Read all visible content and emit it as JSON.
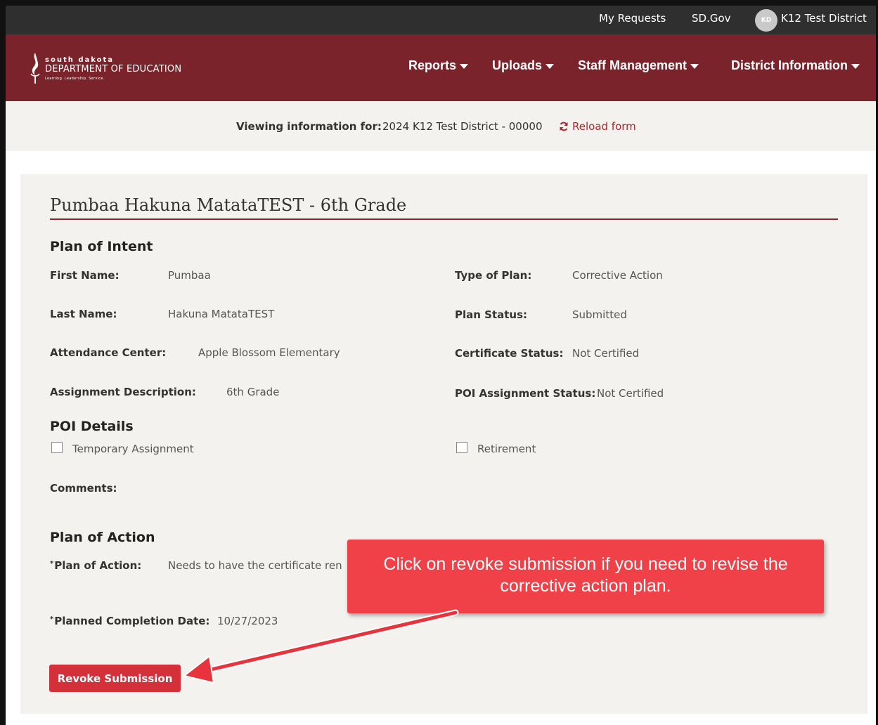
{
  "topbar": {
    "my_requests": "My Requests",
    "sdgov": "SD.Gov",
    "avatar_initials": "KD",
    "district": "K12 Test District"
  },
  "logo": {
    "line1": "south dakota",
    "line2": "DEPARTMENT OF EDUCATION",
    "tagline": "Learning. Leadership. Service."
  },
  "nav": {
    "items": [
      {
        "label": "Reports"
      },
      {
        "label": "Uploads"
      },
      {
        "label": "Staff Management"
      },
      {
        "label": "District Information"
      }
    ]
  },
  "viewing": {
    "label": "Viewing information for:",
    "value": "2024 K12 Test District - 00000",
    "reload": "Reload form"
  },
  "record": {
    "title": "Pumbaa Hakuna MatataTEST - 6th Grade",
    "plan_of_intent": {
      "heading": "Plan of Intent",
      "first_name_label": "First Name:",
      "first_name": "Pumbaa",
      "last_name_label": "Last Name:",
      "last_name": "Hakuna MatataTEST",
      "attendance_center_label": "Attendance Center:",
      "attendance_center": "Apple Blossom Elementary",
      "assignment_description_label": "Assignment Description:",
      "assignment_description": "6th Grade",
      "type_of_plan_label": "Type of Plan:",
      "type_of_plan": "Corrective Action",
      "plan_status_label": "Plan Status:",
      "plan_status": "Submitted",
      "certificate_status_label": "Certificate Status:",
      "certificate_status": "Not Certified",
      "poi_assignment_status_label": "POI Assignment Status:",
      "poi_assignment_status": "Not Certified"
    },
    "poi_details": {
      "heading": "POI Details",
      "temporary_assignment": "Temporary Assignment",
      "retirement": "Retirement",
      "comments_label": "Comments:"
    },
    "plan_of_action": {
      "heading": "Plan of Action",
      "required_mark": "*",
      "plan_label": "Plan of Action:",
      "plan_value": "Needs to have the certificate ren",
      "date_label": "Planned Completion Date:",
      "date_value": "10/27/2023"
    },
    "revoke_button": "Revoke Submission"
  },
  "callout": {
    "text": "Click on revoke submission if you need to revise the corrective action plan."
  },
  "colors": {
    "nav_bg": "#7a232a",
    "topbar_bg": "#2f2f2f",
    "accent": "#d4303a",
    "callout": "#f04148",
    "panel_bg": "#f4f2ee"
  }
}
